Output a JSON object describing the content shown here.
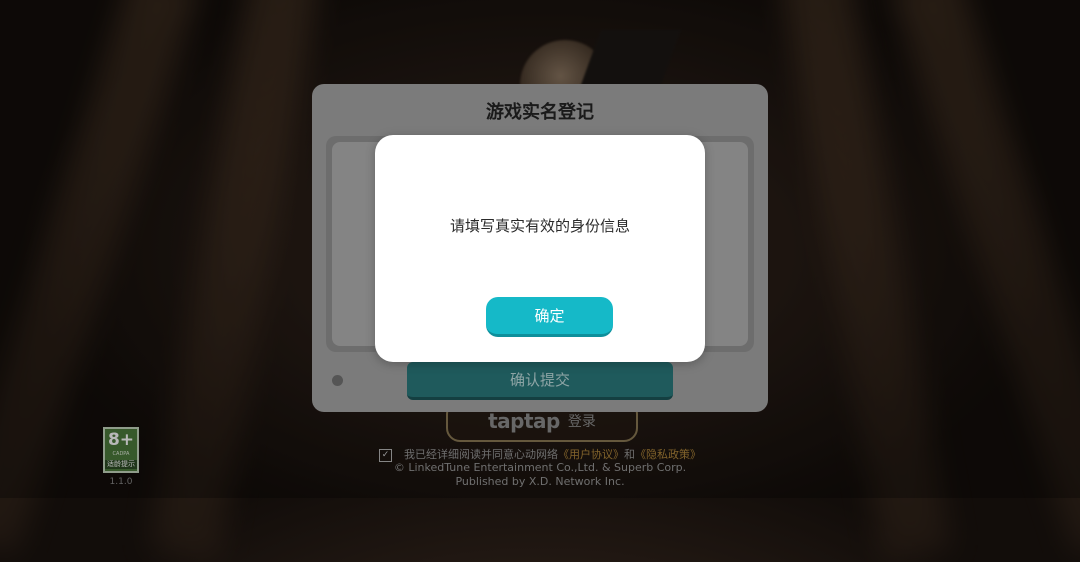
{
  "panel": {
    "title": "游戏实名登记",
    "submit_label": "确认提交"
  },
  "dialog": {
    "message": "请填写真实有效的身份信息",
    "confirm_label": "确定"
  },
  "login_button": {
    "brand": "taptap",
    "label": "登录"
  },
  "legal": {
    "check_mark": "✓",
    "agree_prefix": "我已经详细阅读并同意心动网络",
    "user_agreement": "《用户协议》",
    "and": "和",
    "privacy_policy": "《隐私政策》",
    "copyright": "© LinkedTune Entertainment Co.,Ltd. & Superb Corp.",
    "publisher": "Published by X.D. Network Inc."
  },
  "age_rating": {
    "rating": "8+",
    "org": "CADPA",
    "caption": "适龄提示"
  },
  "version": "1.1.0",
  "colors": {
    "accent": "#15b9c8",
    "submit_dark": "#1f5a5c",
    "link": "#b58a3c"
  }
}
